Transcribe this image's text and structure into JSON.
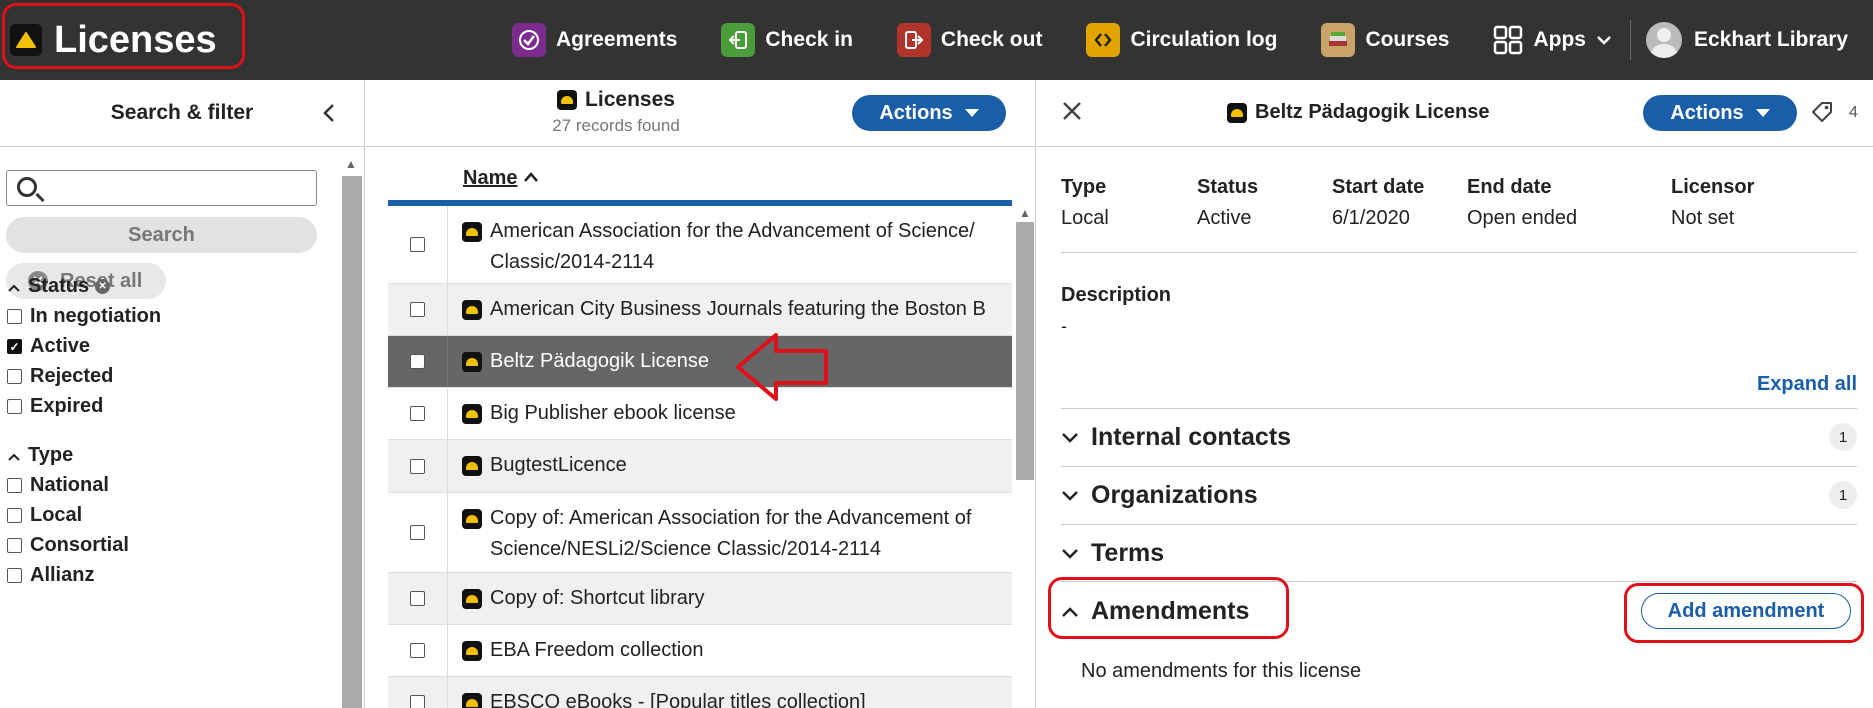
{
  "app": {
    "title": "Licenses"
  },
  "nav": {
    "items": [
      {
        "label": "Agreements",
        "icon": "agreements-icon",
        "color": "#7b2d8e"
      },
      {
        "label": "Check in",
        "icon": "check-in-icon",
        "color": "#4a9d3a"
      },
      {
        "label": "Check out",
        "icon": "check-out-icon",
        "color": "#b0342c"
      },
      {
        "label": "Circulation log",
        "icon": "circulation-log-icon",
        "color": "#e2a500"
      },
      {
        "label": "Courses",
        "icon": "courses-icon",
        "color": "#c9a46a"
      },
      {
        "label": "Apps",
        "icon": "apps-grid-icon",
        "color": "#333333"
      }
    ],
    "user": "Eckhart Library"
  },
  "filter": {
    "header": "Search & filter",
    "search_button": "Search",
    "reset_button": "Reset all",
    "status": {
      "title": "Status",
      "options": [
        {
          "label": "In negotiation",
          "checked": false
        },
        {
          "label": "Active",
          "checked": true
        },
        {
          "label": "Rejected",
          "checked": false
        },
        {
          "label": "Expired",
          "checked": false
        }
      ]
    },
    "type": {
      "title": "Type",
      "options": [
        {
          "label": "National",
          "checked": false
        },
        {
          "label": "Local",
          "checked": false
        },
        {
          "label": "Consortial",
          "checked": false
        },
        {
          "label": "Allianz",
          "checked": false
        }
      ]
    }
  },
  "results": {
    "title": "Licenses",
    "count": "27 records found",
    "actions": "Actions",
    "column_name": "Name",
    "rows": [
      {
        "name": "American Association for the Advancement of Science/",
        "name2": "Classic/2014-2114"
      },
      {
        "name": "American City Business Journals featuring the Boston B"
      },
      {
        "name": "Beltz Pädagogik License",
        "selected": true
      },
      {
        "name": "Big Publisher ebook license"
      },
      {
        "name": "BugtestLicence"
      },
      {
        "name": "Copy of: American Association for the Advancement of",
        "name2": "Science/NESLi2/Science Classic/2014-2114"
      },
      {
        "name": "Copy of: Shortcut library"
      },
      {
        "name": "EBA Freedom collection"
      },
      {
        "name": "EBSCO eBooks - [Popular titles collection]"
      }
    ]
  },
  "detail": {
    "title": "Beltz Pädagogik License",
    "actions": "Actions",
    "tag_count": "4",
    "fields": [
      {
        "label": "Type",
        "value": "Local"
      },
      {
        "label": "Status",
        "value": "Active"
      },
      {
        "label": "Start date",
        "value": "6/1/2020"
      },
      {
        "label": "End date",
        "value": "Open ended"
      },
      {
        "label": "Licensor",
        "value": "Not set"
      }
    ],
    "description_label": "Description",
    "description_value": "-",
    "expand_all": "Expand all",
    "sections": {
      "internal_contacts": {
        "label": "Internal contacts",
        "count": "1"
      },
      "organizations": {
        "label": "Organizations",
        "count": "1"
      },
      "terms": {
        "label": "Terms"
      },
      "amendments": {
        "label": "Amendments"
      }
    },
    "add_amendment": "Add amendment",
    "no_amendments": "No amendments for this license"
  },
  "colors": {
    "topbar": "#333333",
    "accent": "#1a5ea8",
    "callout": "#e0101a",
    "selected_row": "#666666"
  }
}
